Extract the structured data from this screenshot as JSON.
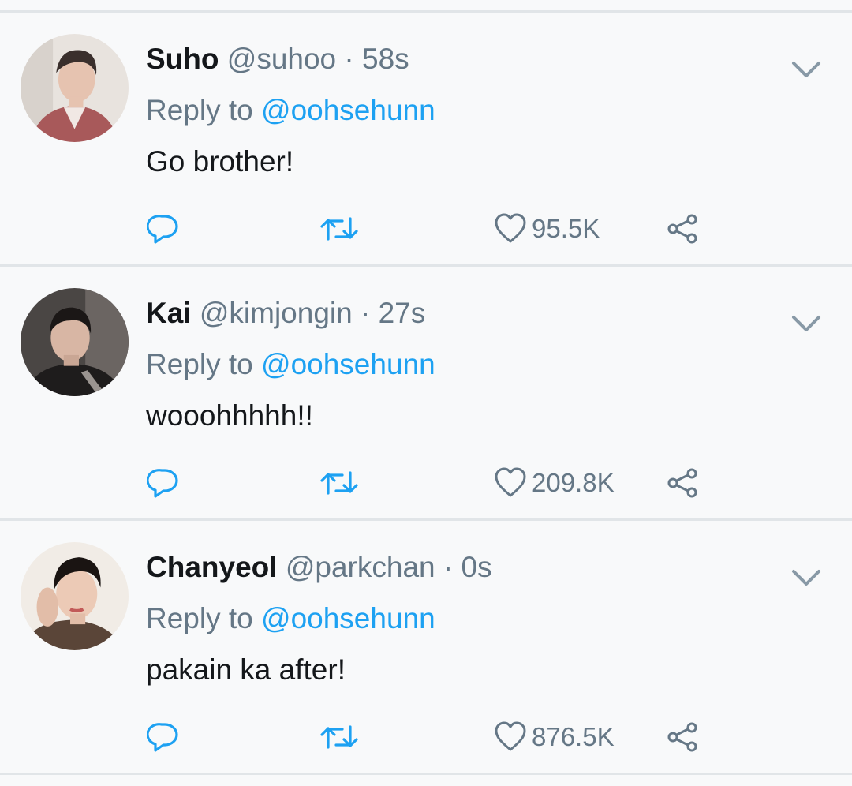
{
  "tweets": [
    {
      "name": "Suho",
      "handle": "@suhoo",
      "sep": "·",
      "time": "58s",
      "reply_prefix": "Reply to",
      "reply_to": "@oohsehunn",
      "text": "Go brother!",
      "likes": "95.5K",
      "avatar_colors": {
        "bg": "#e8e3de",
        "shirt": "#a8595a",
        "hair": "#3a2f2c",
        "skin": "#e6c3b0"
      }
    },
    {
      "name": "Kai",
      "handle": "@kimjongin",
      "sep": "·",
      "time": "27s",
      "reply_prefix": "Reply to",
      "reply_to": "@oohsehunn",
      "text": "wooohhhhh!!",
      "likes": "209.8K",
      "avatar_colors": {
        "bg": "#4a4644",
        "shirt": "#1e1c1c",
        "hair": "#1b1716",
        "skin": "#d8b6a4"
      }
    },
    {
      "name": "Chanyeol",
      "handle": "@parkchan",
      "sep": "·",
      "time": "0s",
      "reply_prefix": "Reply to",
      "reply_to": "@oohsehunn",
      "text": "pakain ka after!",
      "likes": "876.5K",
      "avatar_colors": {
        "bg": "#f1ece6",
        "shirt": "#5a4538",
        "hair": "#1a1412",
        "skin": "#eccab6"
      }
    }
  ],
  "icons": {
    "reply": "reply-icon",
    "retweet": "retweet-icon",
    "like": "heart-icon",
    "share": "share-icon",
    "menu": "chevron-down-icon"
  },
  "colors": {
    "text": "#14171a",
    "muted": "#657786",
    "link": "#1da1f2",
    "divider": "#e1e5e8",
    "background": "#f8f9fa"
  }
}
